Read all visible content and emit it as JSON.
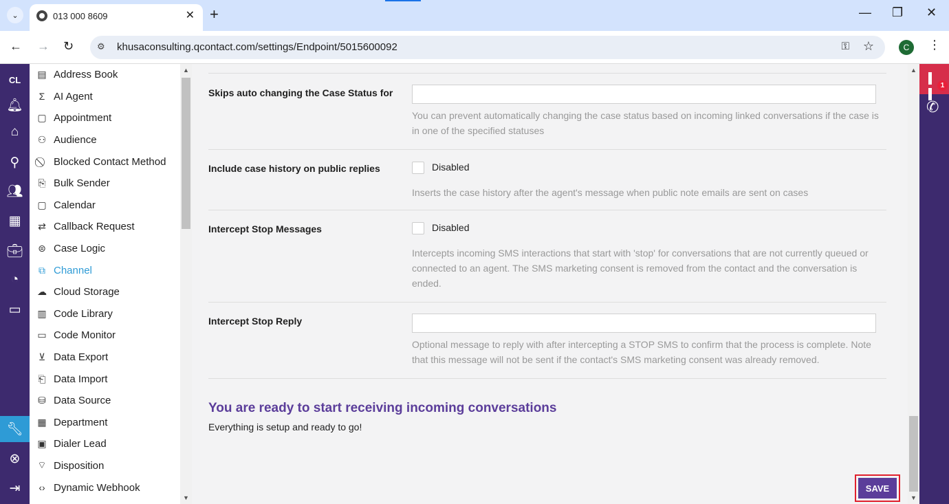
{
  "browser": {
    "tab_title": "013 000 8609",
    "tab_close": "✕",
    "new_tab": "+",
    "url": "khusaconsulting.qcontact.com/settings/Endpoint/5015600092",
    "profile_initial": "C",
    "minimize": "—",
    "restore": "❐",
    "close": "✕"
  },
  "rail": {
    "initials": "CL"
  },
  "menu": {
    "items": [
      {
        "label": "Address Book",
        "icon": "address-book-icon"
      },
      {
        "label": "AI Agent",
        "icon": "sigma-icon"
      },
      {
        "label": "Appointment",
        "icon": "calendar-icon"
      },
      {
        "label": "Audience",
        "icon": "people-icon"
      },
      {
        "label": "Blocked Contact Method",
        "icon": "blocked-icon"
      },
      {
        "label": "Bulk Sender",
        "icon": "bulk-sender-icon"
      },
      {
        "label": "Calendar",
        "icon": "calendar-icon"
      },
      {
        "label": "Callback Request",
        "icon": "callback-icon"
      },
      {
        "label": "Case Logic",
        "icon": "case-logic-icon"
      },
      {
        "label": "Channel",
        "icon": "external-link-icon"
      },
      {
        "label": "Cloud Storage",
        "icon": "cloud-upload-icon"
      },
      {
        "label": "Code Library",
        "icon": "library-icon"
      },
      {
        "label": "Code Monitor",
        "icon": "code-monitor-icon"
      },
      {
        "label": "Data Export",
        "icon": "download-icon"
      },
      {
        "label": "Data Import",
        "icon": "import-icon"
      },
      {
        "label": "Data Source",
        "icon": "database-icon"
      },
      {
        "label": "Department",
        "icon": "building-icon"
      },
      {
        "label": "Dialer Lead",
        "icon": "contact-card-icon"
      },
      {
        "label": "Disposition",
        "icon": "tag-icon"
      },
      {
        "label": "Dynamic Webhook",
        "icon": "code-icon"
      }
    ],
    "active_label": "Channel"
  },
  "settings": {
    "skip_status": {
      "label": "Skips auto changing the Case Status for",
      "value": "",
      "help": "You can prevent automatically changing the case status based on incoming linked conversations if the case is in one of the specified statuses"
    },
    "case_history": {
      "label": "Include case history on public replies",
      "state": "Disabled",
      "help": "Inserts the case history after the agent's message when public note emails are sent on cases"
    },
    "intercept_stop": {
      "label": "Intercept Stop Messages",
      "state": "Disabled",
      "help": "Intercepts incoming SMS interactions that start with 'stop' for conversations that are not currently queued or connected to an agent. The SMS marketing consent is removed from the contact and the conversation is ended."
    },
    "intercept_reply": {
      "label": "Intercept Stop Reply",
      "value": "",
      "help": "Optional message to reply with after intercepting a STOP SMS to confirm that the process is complete. Note that this message will not be sent if the contact's SMS marketing consent was already removed."
    }
  },
  "ready": {
    "title": "You are ready to start receiving incoming conversations",
    "subtitle": "Everything is setup and ready to go!"
  },
  "save_label": "SAVE",
  "right_rail": {
    "badge": "1"
  },
  "colors": {
    "rail": "#3d2a6e",
    "accent": "#5b3d9a",
    "active_link": "#2e9bd6",
    "alert": "#d62e4a"
  }
}
